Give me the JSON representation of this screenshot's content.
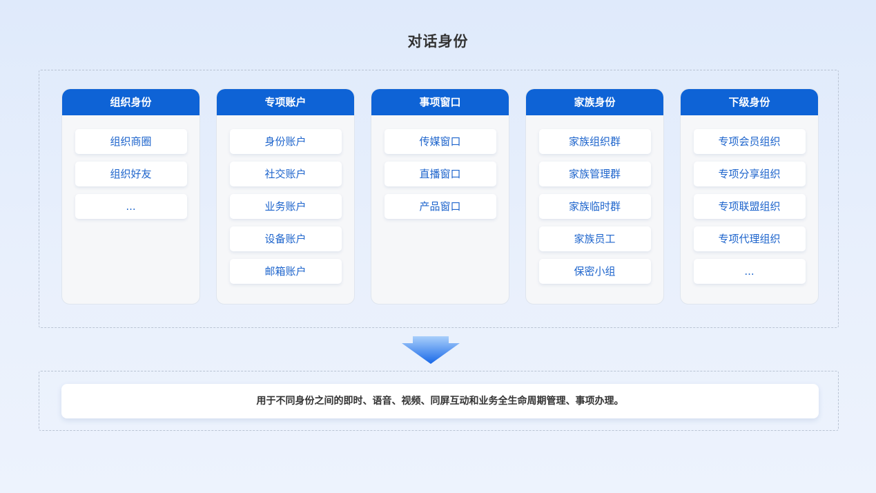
{
  "title": "对话身份",
  "columns": [
    {
      "header": "组织身份",
      "items": [
        "组织商圈",
        "组织好友",
        "..."
      ]
    },
    {
      "header": "专项账户",
      "items": [
        "身份账户",
        "社交账户",
        "业务账户",
        "设备账户",
        "邮箱账户"
      ]
    },
    {
      "header": "事项窗口",
      "items": [
        "传媒窗口",
        "直播窗口",
        "产品窗口"
      ]
    },
    {
      "header": "家族身份",
      "items": [
        "家族组织群",
        "家族管理群",
        "家族临时群",
        "家族员工",
        "保密小组"
      ]
    },
    {
      "header": "下级身份",
      "items": [
        "专项会员组织",
        "专项分享组织",
        "专项联盟组织",
        "专项代理组织",
        "..."
      ]
    }
  ],
  "arrow_icon": "down-arrow-icon",
  "description": "用于不同身份之间的即时、语音、视频、同屏互动和业务全生命周期管理、事项办理。",
  "colors": {
    "header_bg": "#0e63d6",
    "item_text": "#1d64cc",
    "title_text": "#333333",
    "arrow_light": "#a9cffb",
    "arrow_dark": "#1868e8"
  }
}
